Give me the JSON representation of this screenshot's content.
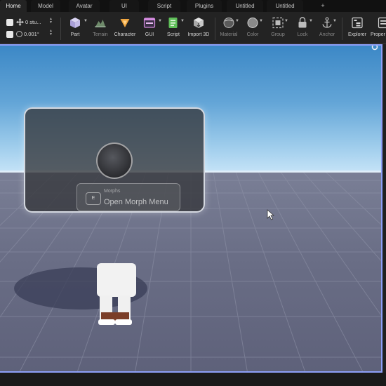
{
  "tabs": [
    {
      "label": "Home",
      "active": true
    },
    {
      "label": "Model",
      "active": false
    },
    {
      "label": "Avatar",
      "active": false
    },
    {
      "label": "UI",
      "active": false
    },
    {
      "label": "Script",
      "active": false
    },
    {
      "label": "Plugins",
      "active": false
    },
    {
      "label": "Untitled",
      "active": false
    },
    {
      "label": "Untitled",
      "active": false
    }
  ],
  "new_tab_label": "+",
  "transform": {
    "move_value": "0 stu...",
    "rotate_value": "0.001°"
  },
  "tools": {
    "part": "Part",
    "terrain": "Terrain",
    "character": "Character",
    "gui": "GUI",
    "script": "Script",
    "import3d": "Import 3D",
    "material": "Material",
    "color": "Color",
    "group": "Group",
    "lock": "Lock",
    "anchor": "Anchor",
    "explorer": "Explorer",
    "properties": "Proper"
  },
  "prompt": {
    "key": "E",
    "object_text": "Morphs",
    "action_text": "Open Morph Menu"
  },
  "colors": {
    "selection_outline": "#8d9ff8",
    "sky_top": "#3c88c6",
    "ground": "#6a6e86"
  }
}
